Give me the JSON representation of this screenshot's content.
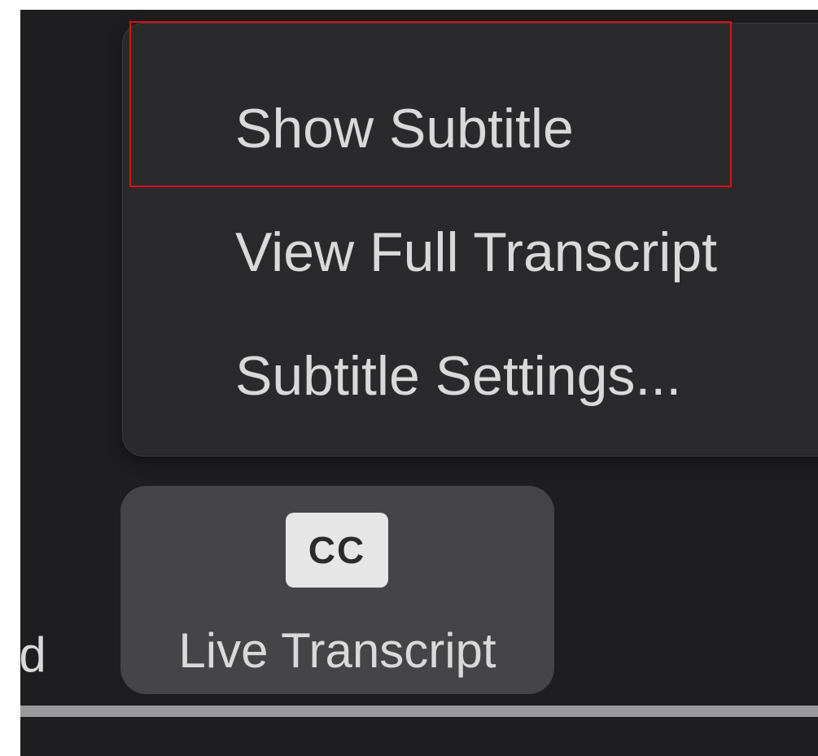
{
  "menu": {
    "items": [
      {
        "label": "Show Subtitle"
      },
      {
        "label": "View Full Transcript"
      },
      {
        "label": "Subtitle Settings..."
      }
    ]
  },
  "toolbar": {
    "prev_button_label_fragment": "nd",
    "live_transcript": {
      "icon_text": "CC",
      "label": "Live Transcript"
    }
  },
  "colors": {
    "background": "#1e1e20",
    "menu_background": "#2a2a2c",
    "button_background": "#454547",
    "text": "#d9d9d9",
    "highlight_border": "#e01010"
  }
}
